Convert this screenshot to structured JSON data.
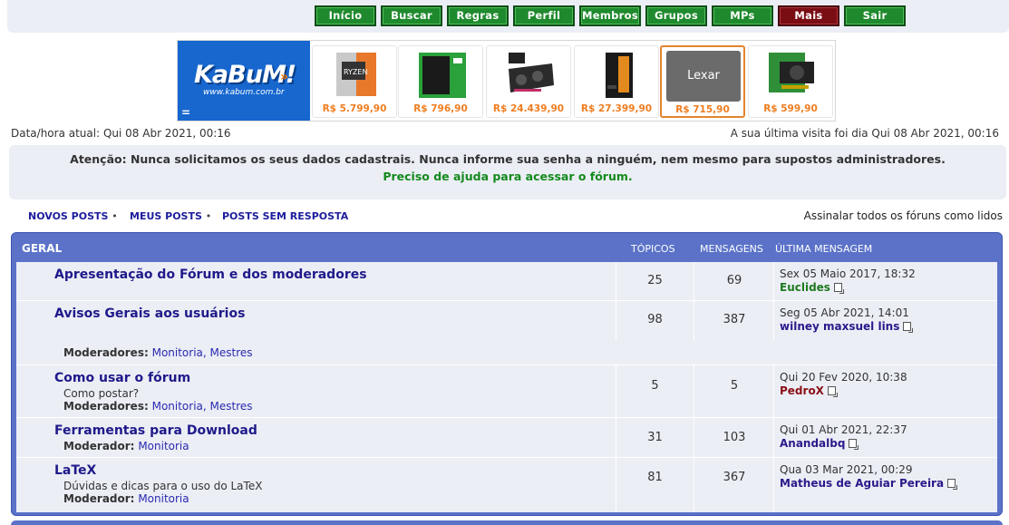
{
  "nav": {
    "items": [
      {
        "label": "Início"
      },
      {
        "label": "Buscar"
      },
      {
        "label": "Regras"
      },
      {
        "label": "Perfil"
      },
      {
        "label": "Membros"
      },
      {
        "label": "Grupos"
      },
      {
        "label": "MPs"
      },
      {
        "label": "Mais"
      },
      {
        "label": "Sair"
      }
    ],
    "colors": {
      "green": "#1f8a2d",
      "red": "#7a0d14"
    }
  },
  "ad": {
    "brand": "KaBuM!",
    "url": "www.kabum.com.br",
    "products": [
      {
        "icon": "ryzen-cpu-box-icon",
        "price": "R$ 5.799,90"
      },
      {
        "icon": "wd-green-ssd-icon",
        "price": "R$ 796,90"
      },
      {
        "icon": "graphics-card-icon",
        "price": "R$ 24.439,90"
      },
      {
        "icon": "gpu-box-icon",
        "price": "R$ 27.399,90"
      },
      {
        "icon": "lexar-ssd-icon",
        "price": "R$ 715,90",
        "label": "Lexar"
      },
      {
        "icon": "green-graphics-card-icon",
        "price": "R$ 599,90"
      }
    ]
  },
  "info": {
    "current_time": "Data/hora atual: Qui 08 Abr 2021, 00:16",
    "last_visit": "A sua última visita foi dia Qui 08 Abr 2021, 00:16"
  },
  "notice": {
    "line1": "Atenção: Nunca solicitamos os seus dados cadastrais. Nunca informe sua senha a ninguém, nem mesmo para supostos administradores.",
    "line2": "Preciso de ajuda para acessar o fórum."
  },
  "quicklinks": {
    "new_posts": "NOVOS POSTS",
    "my_posts": "MEUS POSTS",
    "unanswered": "POSTS SEM RESPOSTA",
    "mark_read": "Assinalar todos os fóruns como lidos"
  },
  "forum": {
    "category": "GERAL",
    "col_topics": "TÓPICOS",
    "col_posts": "MENSAGENS",
    "col_last": "ÚLTIMA MENSAGEM",
    "rows": [
      {
        "name": "Apresentação do Fórum e dos moderadores",
        "topics": "25",
        "posts": "69",
        "last_date": "Sex 05 Maio 2017, 18:32",
        "last_user": "Euclides",
        "last_user_color": "#1f7a1f"
      },
      {
        "name": "Avisos Gerais aos usuários",
        "topics": "98",
        "posts": "387",
        "last_date": "Seg 05 Abr 2021, 14:01",
        "last_user": "wilney maxsuel lins",
        "last_user_color": "#2a1a8a",
        "mod_label": "Moderadores:",
        "mods": "Monitoria, Mestres"
      },
      {
        "name": "Como usar o fórum",
        "desc": "Como postar?",
        "topics": "5",
        "posts": "5",
        "last_date": "Qui 20 Fev 2020, 10:38",
        "last_user": "PedroX",
        "last_user_color": "#8a0f16",
        "mod_label": "Moderadores:",
        "mods": "Monitoria, Mestres"
      },
      {
        "name": "Ferramentas para Download",
        "topics": "31",
        "posts": "103",
        "last_date": "Qui 01 Abr 2021, 22:37",
        "last_user": "Anandalbq",
        "last_user_color": "#2a1a8a",
        "mod_label": "Moderador:",
        "mods": "Monitoria"
      },
      {
        "name": "LaTeX",
        "desc": "Dúvidas e dicas para o uso do LaTeX",
        "topics": "81",
        "posts": "367",
        "last_date": "Qua 03 Mar 2021, 00:29",
        "last_user": "Matheus de Aguiar Pereira",
        "last_user_color": "#2a1a8a",
        "mod_label": "Moderador:",
        "mods": "Monitoria"
      }
    ]
  }
}
